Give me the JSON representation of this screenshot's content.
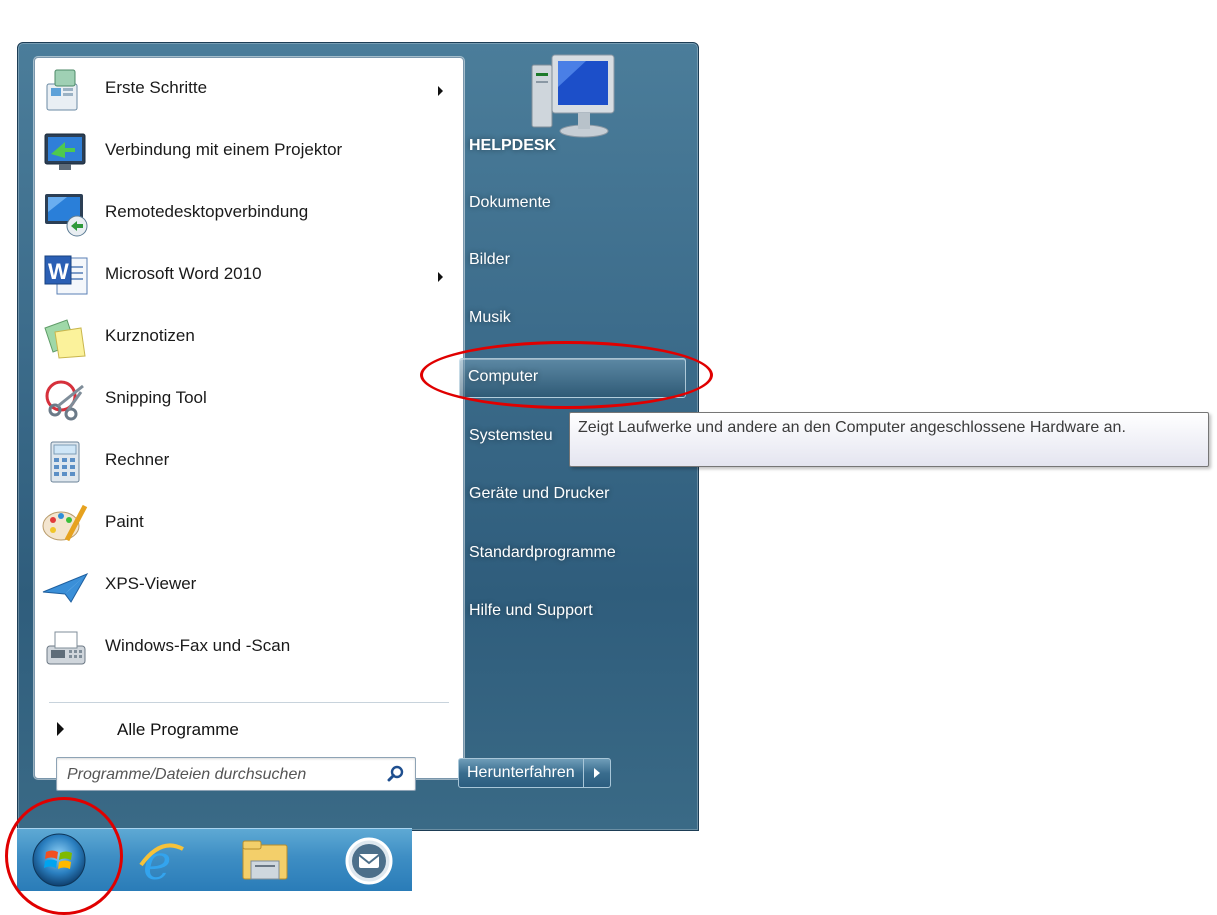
{
  "programs": [
    {
      "label": "Erste Schritte",
      "icon": "getting-started-icon",
      "submenu": true
    },
    {
      "label": "Verbindung mit einem Projektor",
      "icon": "projector-icon",
      "submenu": false
    },
    {
      "label": "Remotedesktopverbindung",
      "icon": "remote-desktop-icon",
      "submenu": false
    },
    {
      "label": "Microsoft Word 2010",
      "icon": "word-icon",
      "submenu": true
    },
    {
      "label": "Kurznotizen",
      "icon": "sticky-notes-icon",
      "submenu": false
    },
    {
      "label": "Snipping Tool",
      "icon": "snipping-tool-icon",
      "submenu": false
    },
    {
      "label": "Rechner",
      "icon": "calculator-icon",
      "submenu": false
    },
    {
      "label": "Paint",
      "icon": "paint-icon",
      "submenu": false
    },
    {
      "label": "XPS-Viewer",
      "icon": "xps-viewer-icon",
      "submenu": false
    },
    {
      "label": "Windows-Fax und -Scan",
      "icon": "fax-scan-icon",
      "submenu": false
    }
  ],
  "all_programs": "Alle Programme",
  "search": {
    "placeholder": "Programme/Dateien durchsuchen"
  },
  "right_pane": {
    "items": [
      "HELPDESK",
      "Dokumente",
      "Bilder",
      "Musik",
      "Computer",
      "Systemsteu",
      "Geräte und Drucker",
      "Standardprogramme",
      "Hilfe und Support"
    ],
    "highlighted": "Computer"
  },
  "shutdown": {
    "label": "Herunterfahren"
  },
  "tooltip": {
    "text": "Zeigt Laufwerke und andere an den Computer angeschlossene Hardware an."
  },
  "taskbar": {
    "icons": [
      "windows-start-icon",
      "internet-explorer-icon",
      "file-explorer-icon",
      "mail-icon"
    ]
  },
  "colors": {
    "annotation": "#e00000",
    "menu_frame": "#3d6d8c",
    "taskbar": "#3e8ec4"
  }
}
